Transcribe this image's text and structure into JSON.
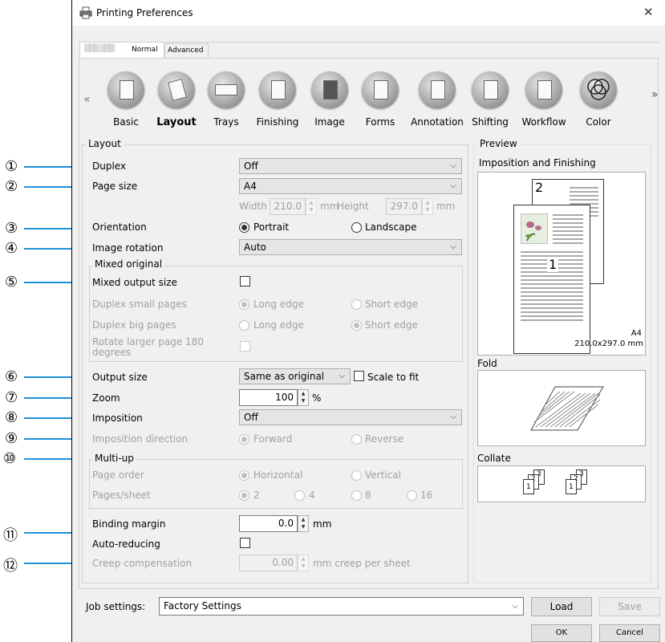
{
  "window": {
    "title": "Printing Preferences",
    "close_glyph": "✕"
  },
  "tabs": {
    "printer_name": "▒▒▒ ▒▒▒",
    "normal": "Normal",
    "advanced": "Advanced"
  },
  "categories": {
    "prev": "«",
    "next": "»",
    "items": [
      "Basic",
      "Layout",
      "Trays",
      "Finishing",
      "Image",
      "Forms",
      "Annotation",
      "Shifting",
      "Workflow",
      "Color"
    ]
  },
  "layout": {
    "group_title": "Layout",
    "duplex_label": "Duplex",
    "duplex_value": "Off",
    "page_size_label": "Page size",
    "page_size_value": "A4",
    "width_label": "Width",
    "width_value": "210.0",
    "mm1": "mm",
    "height_label": "Height",
    "height_value": "297.0",
    "mm2": "mm",
    "orientation_label": "Orientation",
    "portrait": "Portrait",
    "landscape": "Landscape",
    "rotation_label": "Image rotation",
    "rotation_value": "Auto",
    "mixed_title": "Mixed original",
    "mixed_output_label": "Mixed output size",
    "duplex_small_label": "Duplex small pages",
    "duplex_big_label": "Duplex big pages",
    "long_edge": "Long edge",
    "short_edge": "Short edge",
    "rotate_label_1": "Rotate larger page 180",
    "rotate_label_2": "degrees",
    "output_size_label": "Output size",
    "output_size_value": "Same as original",
    "scale_to_fit": "Scale to fit",
    "zoom_label": "Zoom",
    "zoom_value": "100",
    "zoom_unit": "%",
    "imposition_label": "Imposition",
    "imposition_value": "Off",
    "imp_dir_label": "Imposition direction",
    "forward": "Forward",
    "reverse": "Reverse",
    "multiup_title": "Multi-up",
    "page_order_label": "Page order",
    "horizontal": "Horizontal",
    "vertical": "Vertical",
    "pages_sheet_label": "Pages/sheet",
    "ps2": "2",
    "ps4": "4",
    "ps8": "8",
    "ps16": "16",
    "binding_label": "Binding margin",
    "binding_value": "0.0",
    "binding_unit": "mm",
    "auto_reducing_label": "Auto-reducing",
    "creep_label": "Creep compensation",
    "creep_value": "0.00",
    "creep_unit": "mm creep per sheet"
  },
  "preview": {
    "title": "Preview",
    "imposition_title": "Imposition and Finishing",
    "page_back_num": "2",
    "page_front_num": "1",
    "paper_name": "A4",
    "paper_dims": "210.0x297.0 mm",
    "fold_title": "Fold",
    "collate_title": "Collate",
    "c1": "1",
    "c2": "2",
    "c3": "3"
  },
  "bottom": {
    "job_label": "Job settings:",
    "job_value": "Factory Settings",
    "load": "Load",
    "save": "Save",
    "ok": "OK",
    "cancel": "Cancel"
  },
  "callouts": [
    "①",
    "②",
    "③",
    "④",
    "⑤",
    "⑥",
    "⑦",
    "⑧",
    "⑨",
    "⑩",
    "⑪",
    "⑫"
  ],
  "colors": {
    "callout_line": "#1e90d6",
    "disabled_text": "#a0a0a0"
  }
}
